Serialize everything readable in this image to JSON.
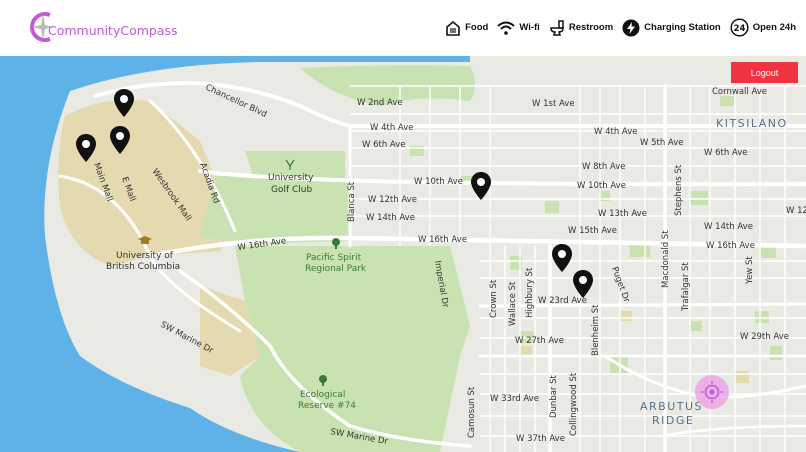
{
  "app": {
    "name": "CommunityCompass"
  },
  "legend": [
    {
      "icon": "food-icon",
      "label": "Food"
    },
    {
      "icon": "wifi-icon",
      "label": "Wi-fi"
    },
    {
      "icon": "restroom-icon",
      "label": "Restroom"
    },
    {
      "icon": "charging-station-icon",
      "label": "Charging Station"
    },
    {
      "icon": "open-24h-icon",
      "label": "Open 24h",
      "badge": "24"
    }
  ],
  "logout_label": "Logout",
  "map": {
    "colors": {
      "water": "#5fb2e8",
      "land": "#eaeae4",
      "park": "#c9e2b1",
      "campus": "#e5d9b0",
      "road": "#ffffff",
      "location": "#e8a6e6"
    },
    "streets": {
      "chancellor": "Chancellor Blvd",
      "w2nd": "W 2nd Ave",
      "w1st": "W 1st Ave",
      "cornwall": "Cornwall Ave",
      "w4th_a": "W 4th Ave",
      "w4th_b": "W 4th Ave",
      "w5th": "W 5th Ave",
      "w6th_a": "W 6th Ave",
      "w6th_b": "W 6th Ave",
      "w8th": "W 8th Ave",
      "w10th_a": "W 10th Ave",
      "w10th_b": "W 10th Ave",
      "w12th": "W 12th Ave",
      "w12_trunc": "W 12",
      "w13th": "W 13th Ave",
      "w14th_a": "W 14th Ave",
      "w14th_b": "W 14th Ave",
      "w15th": "W 15th Ave",
      "w16th_a": "W 16th Ave",
      "w16th_b": "W 16th Ave",
      "w16th_c": "W 16th Ave",
      "w23rd": "W 23rd Ave",
      "w27th": "W 27th Ave",
      "w29th": "W 29th Ave",
      "w33rd": "W 33rd Ave",
      "w37th": "W 37th Ave",
      "sw_marine_a": "SW Marine Dr",
      "sw_marine_b": "SW Marine Dr",
      "main_mall": "Main Mall",
      "e_mall": "E Mall",
      "wesbrook": "Wesbrook Mall",
      "acadia": "Acadia Rd",
      "blanca": "Blanca St",
      "imperial": "Imperial Dr",
      "crown": "Crown St",
      "wallace": "Wallace St",
      "highbury": "Highbury St",
      "dunbar": "Dunbar St",
      "collingwood": "Collingwood St",
      "blenheim": "Blenheim St",
      "camosun": "Camosun St",
      "puget": "Puget Dr",
      "macdonald": "Macdonald St",
      "stephens": "Stephens St",
      "trafalgar": "Trafalgar St",
      "yew": "Yew St"
    },
    "places": {
      "kitsilano": "KITSILANO",
      "arbutus": "ARBUTUS",
      "ridge": "RIDGE",
      "golf1": "University",
      "golf2": "Golf Club",
      "ubc1": "University of",
      "ubc2": "British Columbia",
      "spirit1": "Pacific Spirit",
      "spirit2": "Regional Park",
      "eco1": "Ecological",
      "eco2": "Reserve #74"
    }
  }
}
